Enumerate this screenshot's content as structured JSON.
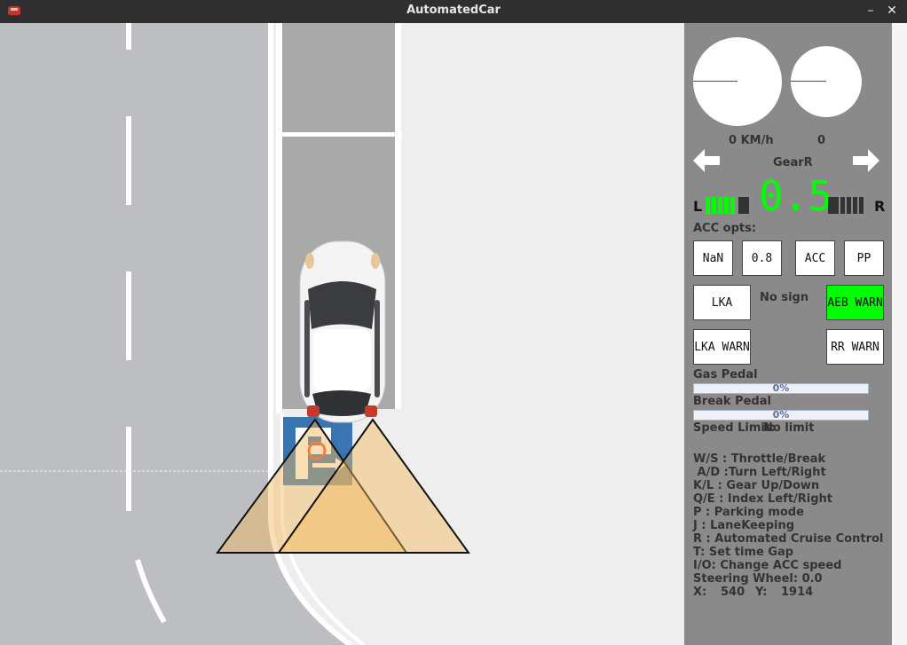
{
  "window": {
    "title": "AutomatedCar",
    "minimize_symbol": "–",
    "close_symbol": "✕"
  },
  "dashboard": {
    "speed_text": "0 KM/h",
    "rpm_text": "0",
    "gear_text": "GearR",
    "left_arrow_icon": "arrow-left-icon",
    "right_arrow_icon": "arrow-right-icon",
    "left_index_letter": "L",
    "right_index_letter": "R",
    "acc_distance": "0.5",
    "acc_opts_label": "ACC opts:",
    "buttons": {
      "acc_speed": "NaN",
      "time_gap": "0.8",
      "acc": "ACC",
      "pp": "PP",
      "lka": "LKA",
      "aeb_warn": "AEB WARN",
      "lka_warn": "LKA WARN",
      "rr_warn": "RR WARN"
    },
    "sign_text": "No sign",
    "gas_label": "Gas Pedal",
    "gas_value": "0%",
    "gas_fraction": 0,
    "break_label": "Break Pedal",
    "break_value": "0%",
    "break_fraction": 0,
    "speed_limit_label": "Speed Limit:",
    "speed_limit_value": "No limit",
    "help": [
      "W/S : Throttle/Break",
      " A/D :Turn Left/Right",
      "K/L : Gear Up/Down",
      "Q/E : Index Left/Right",
      "P : Parking mode",
      "J : LaneKeeping",
      "R : Automated Cruise Control",
      "T: Set time Gap",
      "I/O: Change ACC speed"
    ],
    "steering_label": "Steering Wheel: 0.0",
    "x_label": "X:",
    "x_value": "540",
    "y_label": "Y:",
    "y_value": "1914"
  },
  "colors": {
    "active_green": "#00ff00",
    "warn_active": "#00ff00",
    "panel_bg": "#8a8a8a",
    "road": "#bcbec1"
  }
}
